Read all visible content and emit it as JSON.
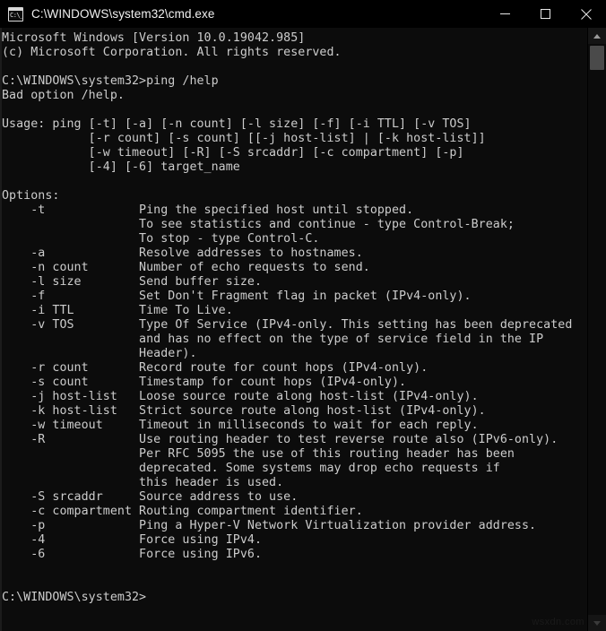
{
  "window": {
    "title": "C:\\WINDOWS\\system32\\cmd.exe",
    "icon_name": "cmd-console-icon",
    "icon_glyph": "C:\\_",
    "background_color": "#0c0c0c",
    "text_color": "#cccccc",
    "titlebar_color": "#000000"
  },
  "window_controls": {
    "minimize_label": "Minimize",
    "maximize_label": "Maximize",
    "close_label": "Close"
  },
  "scrollbar": {
    "up_label": "Scroll up",
    "down_label": "Scroll down",
    "thumb_label": "Scroll thumb"
  },
  "watermark": {
    "text": "wsxdn.com"
  },
  "console": {
    "banner": [
      "Microsoft Windows [Version 10.0.19042.985]",
      "(c) Microsoft Corporation. All rights reserved."
    ],
    "prompt_path": "C:\\WINDOWS\\system32>",
    "command": "ping /help",
    "error_line": "Bad option /help.",
    "usage_lines": [
      "Usage: ping [-t] [-a] [-n count] [-l size] [-f] [-i TTL] [-v TOS]",
      "            [-r count] [-s count] [[-j host-list] | [-k host-list]]",
      "            [-w timeout] [-R] [-S srcaddr] [-c compartment] [-p]",
      "            [-4] [-6] target_name"
    ],
    "options_header": "Options:",
    "options": [
      {
        "flag": "-t",
        "desc": [
          "Ping the specified host until stopped.",
          "To see statistics and continue - type Control-Break;",
          "To stop - type Control-C."
        ]
      },
      {
        "flag": "-a",
        "desc": [
          "Resolve addresses to hostnames."
        ]
      },
      {
        "flag": "-n count",
        "desc": [
          "Number of echo requests to send."
        ]
      },
      {
        "flag": "-l size",
        "desc": [
          "Send buffer size."
        ]
      },
      {
        "flag": "-f",
        "desc": [
          "Set Don't Fragment flag in packet (IPv4-only)."
        ]
      },
      {
        "flag": "-i TTL",
        "desc": [
          "Time To Live."
        ]
      },
      {
        "flag": "-v TOS",
        "desc": [
          "Type Of Service (IPv4-only. This setting has been deprecated",
          "and has no effect on the type of service field in the IP",
          "Header)."
        ]
      },
      {
        "flag": "-r count",
        "desc": [
          "Record route for count hops (IPv4-only)."
        ]
      },
      {
        "flag": "-s count",
        "desc": [
          "Timestamp for count hops (IPv4-only)."
        ]
      },
      {
        "flag": "-j host-list",
        "desc": [
          "Loose source route along host-list (IPv4-only)."
        ]
      },
      {
        "flag": "-k host-list",
        "desc": [
          "Strict source route along host-list (IPv4-only)."
        ]
      },
      {
        "flag": "-w timeout",
        "desc": [
          "Timeout in milliseconds to wait for each reply."
        ]
      },
      {
        "flag": "-R",
        "desc": [
          "Use routing header to test reverse route also (IPv6-only).",
          "Per RFC 5095 the use of this routing header has been",
          "deprecated. Some systems may drop echo requests if",
          "this header is used."
        ]
      },
      {
        "flag": "-S srcaddr",
        "desc": [
          "Source address to use."
        ]
      },
      {
        "flag": "-c compartment",
        "desc": [
          "Routing compartment identifier."
        ]
      },
      {
        "flag": "-p",
        "desc": [
          "Ping a Hyper-V Network Virtualization provider address."
        ]
      },
      {
        "flag": "-4",
        "desc": [
          "Force using IPv4."
        ]
      },
      {
        "flag": "-6",
        "desc": [
          "Force using IPv6."
        ]
      }
    ],
    "layout": {
      "flag_indent": 4,
      "desc_column": 19
    }
  }
}
